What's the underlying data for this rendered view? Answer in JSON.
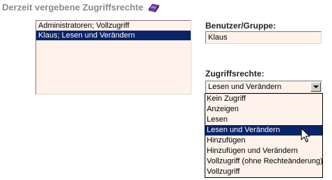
{
  "section": {
    "title": "Derzeit vergebene Zugriffsrechte",
    "icon": "book-icon"
  },
  "userlist": {
    "items": [
      {
        "label": "Administratoren; Vollzugriff",
        "selected": false
      },
      {
        "label": "Klaus; Lesen und Verändern",
        "selected": true
      }
    ]
  },
  "user_field": {
    "label": "Benutzer/Gruppe:",
    "value": "Klaus"
  },
  "rights_field": {
    "label": "Zugriffsrechte:",
    "selected": "Lesen und Verändern",
    "options": [
      "Kein Zugriff",
      "Anzeigen",
      "Lesen",
      "Lesen und Verändern",
      "Hinzufügen",
      "Hinzufügen und Verändern",
      "Vollzugriff (ohne Rechteänderung)",
      "Vollzugriff"
    ],
    "highlighted_index": 3
  },
  "colors": {
    "selection": "#0a246a",
    "field_bg": "#fff2ea",
    "title": "#8a8a8a"
  }
}
